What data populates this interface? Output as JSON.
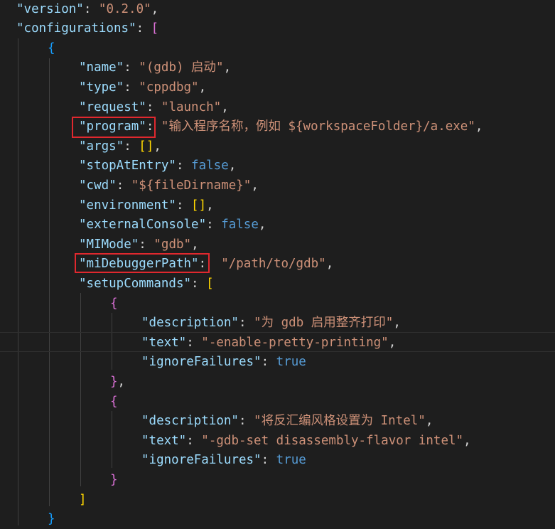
{
  "lines": [
    {
      "indent": "  ",
      "parts": [
        {
          "t": "\"version\"",
          "c": "key"
        },
        {
          "t": ": ",
          "c": "punc"
        },
        {
          "t": "\"0.2.0\"",
          "c": "str"
        },
        {
          "t": ",",
          "c": "punc"
        }
      ]
    },
    {
      "indent": "  ",
      "parts": [
        {
          "t": "\"configurations\"",
          "c": "key"
        },
        {
          "t": ": ",
          "c": "punc"
        },
        {
          "t": "[",
          "c": "b1"
        }
      ]
    },
    {
      "indent": "      ",
      "parts": [
        {
          "t": "{",
          "c": "b2"
        }
      ]
    },
    {
      "indent": "          ",
      "parts": [
        {
          "t": "\"name\"",
          "c": "key"
        },
        {
          "t": ": ",
          "c": "punc"
        },
        {
          "t": "\"(gdb) 启动\"",
          "c": "str"
        },
        {
          "t": ",",
          "c": "punc"
        }
      ]
    },
    {
      "indent": "          ",
      "parts": [
        {
          "t": "\"type\"",
          "c": "key"
        },
        {
          "t": ": ",
          "c": "punc"
        },
        {
          "t": "\"cppdbg\"",
          "c": "str"
        },
        {
          "t": ",",
          "c": "punc"
        }
      ]
    },
    {
      "indent": "          ",
      "parts": [
        {
          "t": "\"request\"",
          "c": "key"
        },
        {
          "t": ": ",
          "c": "punc"
        },
        {
          "t": "\"launch\"",
          "c": "str"
        },
        {
          "t": ",",
          "c": "punc"
        }
      ]
    },
    {
      "indent": "          ",
      "parts": [
        {
          "t": "\"program\"",
          "c": "key"
        },
        {
          "t": ": ",
          "c": "punc"
        },
        {
          "t": "\"输入程序名称，例如 ${workspaceFolder}/a.exe\"",
          "c": "str"
        },
        {
          "t": ",",
          "c": "punc"
        }
      ]
    },
    {
      "indent": "          ",
      "parts": [
        {
          "t": "\"args\"",
          "c": "key"
        },
        {
          "t": ": ",
          "c": "punc"
        },
        {
          "t": "[]",
          "c": "b3"
        },
        {
          "t": ",",
          "c": "punc"
        }
      ]
    },
    {
      "indent": "          ",
      "parts": [
        {
          "t": "\"stopAtEntry\"",
          "c": "key"
        },
        {
          "t": ": ",
          "c": "punc"
        },
        {
          "t": "false",
          "c": "kw"
        },
        {
          "t": ",",
          "c": "punc"
        }
      ]
    },
    {
      "indent": "          ",
      "parts": [
        {
          "t": "\"cwd\"",
          "c": "key"
        },
        {
          "t": ": ",
          "c": "punc"
        },
        {
          "t": "\"${fileDirname}\"",
          "c": "str"
        },
        {
          "t": ",",
          "c": "punc"
        }
      ]
    },
    {
      "indent": "          ",
      "parts": [
        {
          "t": "\"environment\"",
          "c": "key"
        },
        {
          "t": ": ",
          "c": "punc"
        },
        {
          "t": "[]",
          "c": "b3"
        },
        {
          "t": ",",
          "c": "punc"
        }
      ]
    },
    {
      "indent": "          ",
      "parts": [
        {
          "t": "\"externalConsole\"",
          "c": "key"
        },
        {
          "t": ": ",
          "c": "punc"
        },
        {
          "t": "false",
          "c": "kw"
        },
        {
          "t": ",",
          "c": "punc"
        }
      ]
    },
    {
      "indent": "          ",
      "parts": [
        {
          "t": "\"MIMode\"",
          "c": "key"
        },
        {
          "t": ": ",
          "c": "punc"
        },
        {
          "t": "\"gdb\"",
          "c": "str"
        },
        {
          "t": ",",
          "c": "punc"
        }
      ]
    },
    {
      "indent": "          ",
      "parts": [
        {
          "t": "\"miDebuggerPath\"",
          "c": "key"
        },
        {
          "t": ":  ",
          "c": "punc"
        },
        {
          "t": "\"/path/to/gdb\"",
          "c": "str"
        },
        {
          "t": ",",
          "c": "punc"
        }
      ]
    },
    {
      "indent": "          ",
      "parts": [
        {
          "t": "\"setupCommands\"",
          "c": "key"
        },
        {
          "t": ": ",
          "c": "punc"
        },
        {
          "t": "[",
          "c": "b3"
        }
      ]
    },
    {
      "indent": "              ",
      "parts": [
        {
          "t": "{",
          "c": "b1"
        }
      ]
    },
    {
      "indent": "                  ",
      "parts": [
        {
          "t": "\"description\"",
          "c": "key"
        },
        {
          "t": ": ",
          "c": "punc"
        },
        {
          "t": "\"为 gdb 启用整齐打印\"",
          "c": "str"
        },
        {
          "t": ",",
          "c": "punc"
        }
      ]
    },
    {
      "indent": "                  ",
      "parts": [
        {
          "t": "\"text\"",
          "c": "key"
        },
        {
          "t": ": ",
          "c": "punc"
        },
        {
          "t": "\"-enable-pretty-printing\"",
          "c": "str"
        },
        {
          "t": ",",
          "c": "punc"
        }
      ]
    },
    {
      "indent": "                  ",
      "parts": [
        {
          "t": "\"ignoreFailures\"",
          "c": "key"
        },
        {
          "t": ": ",
          "c": "punc"
        },
        {
          "t": "true",
          "c": "kw"
        }
      ]
    },
    {
      "indent": "              ",
      "parts": [
        {
          "t": "}",
          "c": "b1"
        },
        {
          "t": ",",
          "c": "punc"
        }
      ]
    },
    {
      "indent": "              ",
      "parts": [
        {
          "t": "{",
          "c": "b1"
        }
      ]
    },
    {
      "indent": "                  ",
      "parts": [
        {
          "t": "\"description\"",
          "c": "key"
        },
        {
          "t": ": ",
          "c": "punc"
        },
        {
          "t": "\"将反汇编风格设置为 Intel\"",
          "c": "str"
        },
        {
          "t": ",",
          "c": "punc"
        }
      ]
    },
    {
      "indent": "                  ",
      "parts": [
        {
          "t": "\"text\"",
          "c": "key"
        },
        {
          "t": ": ",
          "c": "punc"
        },
        {
          "t": "\"-gdb-set disassembly-flavor intel\"",
          "c": "str"
        },
        {
          "t": ",",
          "c": "punc"
        }
      ]
    },
    {
      "indent": "                  ",
      "parts": [
        {
          "t": "\"ignoreFailures\"",
          "c": "key"
        },
        {
          "t": ": ",
          "c": "punc"
        },
        {
          "t": "true",
          "c": "kw"
        }
      ]
    },
    {
      "indent": "              ",
      "parts": [
        {
          "t": "}",
          "c": "b1"
        }
      ]
    },
    {
      "indent": "          ",
      "parts": [
        {
          "t": "]",
          "c": "b3"
        }
      ]
    },
    {
      "indent": "      ",
      "parts": [
        {
          "t": "}",
          "c": "b2"
        }
      ]
    }
  ],
  "highlighted_keys": [
    "\"program\"",
    "\"miDebuggerPath\""
  ],
  "colors": {
    "background": "#1e1e1e",
    "key": "#9cdcfe",
    "string": "#ce9178",
    "keyword": "#569cd6",
    "punctuation": "#d4d4d4",
    "bracket_level1": "#da70d6",
    "bracket_level2": "#179fff",
    "bracket_level3": "#ffd700",
    "annotation_box": "#e0282e"
  }
}
